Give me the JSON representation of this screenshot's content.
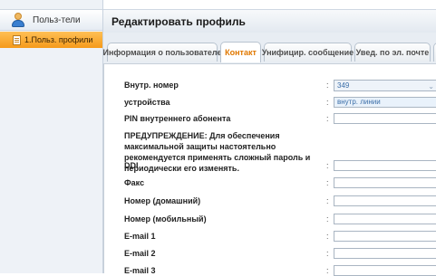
{
  "sidebar": {
    "header_label": "Польз-тели",
    "header_icon": "users-icon",
    "items": [
      {
        "label": "1.Польз. профили",
        "icon": "document-icon",
        "active": true
      }
    ]
  },
  "main": {
    "title": "Редактировать профиль",
    "tabs": [
      {
        "label": "Информация о пользователе",
        "active": false
      },
      {
        "label": "Контакт",
        "active": true
      },
      {
        "label": "Унифицир. сообщение",
        "active": false
      },
      {
        "label": "Увед. по эл. почте",
        "active": false
      }
    ]
  },
  "form": {
    "ext_number": {
      "label": "Внутр. номер",
      "value": "349"
    },
    "devices": {
      "label": "устройства",
      "value": "внутр. линии"
    },
    "pin": {
      "label": "PIN внутреннего абонента",
      "value": ""
    },
    "warning": "ПРЕДУПРЕЖДЕНИЕ: Для обеспечения максимальной защиты настоятельно рекомендуется применять сложный пароль и периодически его изменять.",
    "ddi": {
      "label": "DDI",
      "value": ""
    },
    "fax": {
      "label": "Факс",
      "value": ""
    },
    "home_phone": {
      "label": "Номер (домашний)",
      "value": ""
    },
    "mobile_phone": {
      "label": "Номер (мобильный)",
      "value": ""
    },
    "email1": {
      "label": "E-mail 1",
      "value": ""
    },
    "email2": {
      "label": "E-mail 2",
      "value": ""
    },
    "email3": {
      "label": "E-mail 3",
      "value": ""
    },
    "colon": ":"
  },
  "colors": {
    "accent": "#f59a1a",
    "active_tab_text": "#e07800",
    "select_text": "#3b6ea8"
  }
}
